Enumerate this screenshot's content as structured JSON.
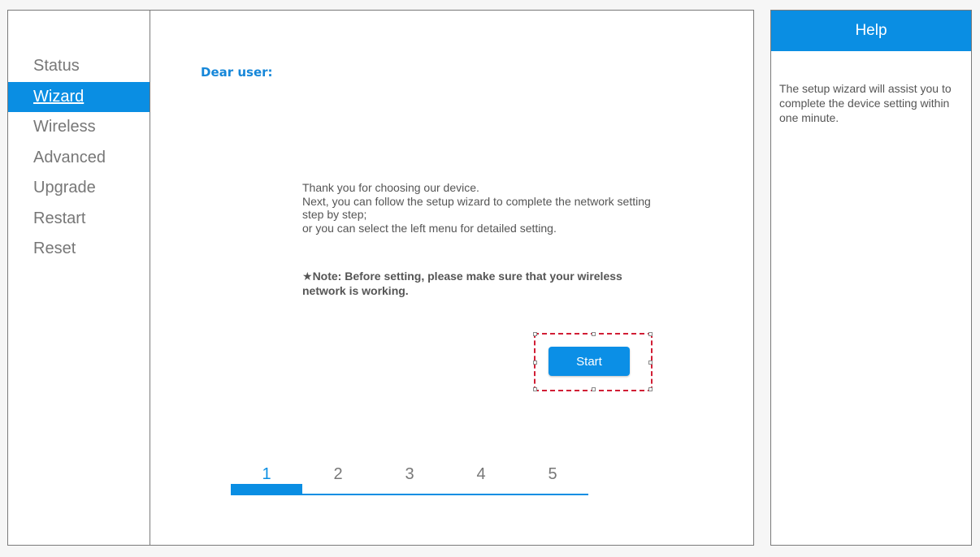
{
  "sidebar": {
    "items": [
      {
        "label": "Status",
        "active": false
      },
      {
        "label": "Wizard",
        "active": true
      },
      {
        "label": "Wireless",
        "active": false
      },
      {
        "label": "Advanced",
        "active": false
      },
      {
        "label": "Upgrade",
        "active": false
      },
      {
        "label": "Restart",
        "active": false
      },
      {
        "label": "Reset",
        "active": false
      }
    ]
  },
  "main": {
    "greeting": "Dear user:",
    "intro_lines": [
      "Thank you for choosing our device.",
      "Next, you can follow the setup wizard to complete the network setting step by step;",
      "or you can select the left menu for detailed setting."
    ],
    "note_icon": "star-icon",
    "note_text": "Note: Before setting, please make sure that your wireless network is working.",
    "start_label": "Start"
  },
  "steps": {
    "labels": [
      "1",
      "2",
      "3",
      "4",
      "5"
    ],
    "current": 1
  },
  "help": {
    "title": "Help",
    "text": "The setup wizard will assist you to complete the device setting within one minute."
  },
  "colors": {
    "accent": "#0a8ee3",
    "selection_outline": "#d11e35",
    "text": "#555555"
  }
}
